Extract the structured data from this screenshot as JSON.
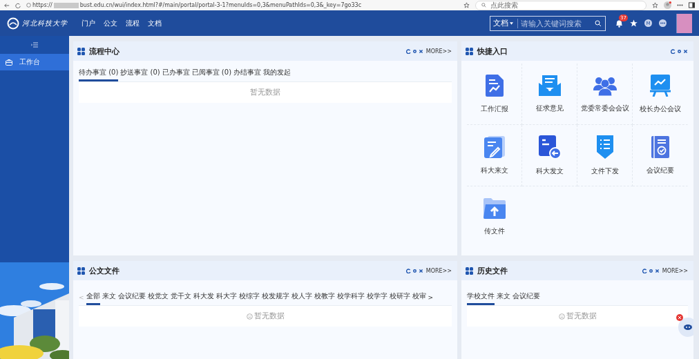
{
  "browser": {
    "url_scheme": "https://",
    "url": "bust.edu.cn/wui/index.html?#/main/portal/portal-3-1?menuIds=0,3&menuPathIds=0,3&_key=7go33c",
    "search_placeholder": "点此搜索"
  },
  "header": {
    "logo_text": "河北科技大学",
    "nav": [
      {
        "label": "门户"
      },
      {
        "label": "公文"
      },
      {
        "label": "流程"
      },
      {
        "label": "文档"
      }
    ],
    "search": {
      "scope": "文档",
      "placeholder": "请输入关键词搜索"
    },
    "notification_count": "37",
    "user_initial": "M"
  },
  "sidebar": {
    "items": [
      {
        "label": "工作台",
        "selected": true
      }
    ]
  },
  "workflow": {
    "title": "流程中心",
    "more": "MORE>>",
    "tabs": [
      {
        "label": "待办事宜 (0)",
        "selected": true
      },
      {
        "label": "抄送事宜 (0)",
        "selected": false
      },
      {
        "label": "已办事宜",
        "selected": false
      },
      {
        "label": "已阅事宜 (0)",
        "selected": false
      },
      {
        "label": "办结事宜",
        "selected": false
      },
      {
        "label": "我的发起",
        "selected": false
      }
    ],
    "empty": "暂无数据"
  },
  "quick_entry": {
    "title": "快捷入口",
    "items": [
      {
        "label": "工作汇报",
        "kind": "report"
      },
      {
        "label": "征求意见",
        "kind": "envelope"
      },
      {
        "label": "党委常委会会议",
        "kind": "group"
      },
      {
        "label": "校长办公会议",
        "kind": "board"
      },
      {
        "label": "科大来文",
        "kind": "edit"
      },
      {
        "label": "科大发文",
        "kind": "send"
      },
      {
        "label": "文件下发",
        "kind": "list"
      },
      {
        "label": "会议纪要",
        "kind": "minutes"
      },
      {
        "label": "传文件",
        "kind": "upload"
      }
    ]
  },
  "documents": {
    "title": "公文文件",
    "more": "MORE>>",
    "prev": "<",
    "next": ">",
    "tabs": [
      {
        "label": "全部",
        "selected": true
      },
      {
        "label": "来文",
        "selected": false
      },
      {
        "label": "会议纪要",
        "selected": false
      },
      {
        "label": "校党文",
        "selected": false
      },
      {
        "label": "党干文",
        "selected": false
      },
      {
        "label": "科大发",
        "selected": false
      },
      {
        "label": "科大字",
        "selected": false
      },
      {
        "label": "校综字",
        "selected": false
      },
      {
        "label": "校发规字",
        "selected": false
      },
      {
        "label": "校人字",
        "selected": false
      },
      {
        "label": "校教字",
        "selected": false
      },
      {
        "label": "校学科字",
        "selected": false
      },
      {
        "label": "校学字",
        "selected": false
      },
      {
        "label": "校研字",
        "selected": false
      },
      {
        "label": "校审",
        "selected": false
      }
    ],
    "empty": "暂无数据"
  },
  "history": {
    "title": "历史文件",
    "more": "MORE>>",
    "tabs": [
      {
        "label": "学校文件",
        "selected": true
      },
      {
        "label": "来文",
        "selected": false
      },
      {
        "label": "会议纪要",
        "selected": false
      }
    ],
    "empty": "暂无数据"
  }
}
